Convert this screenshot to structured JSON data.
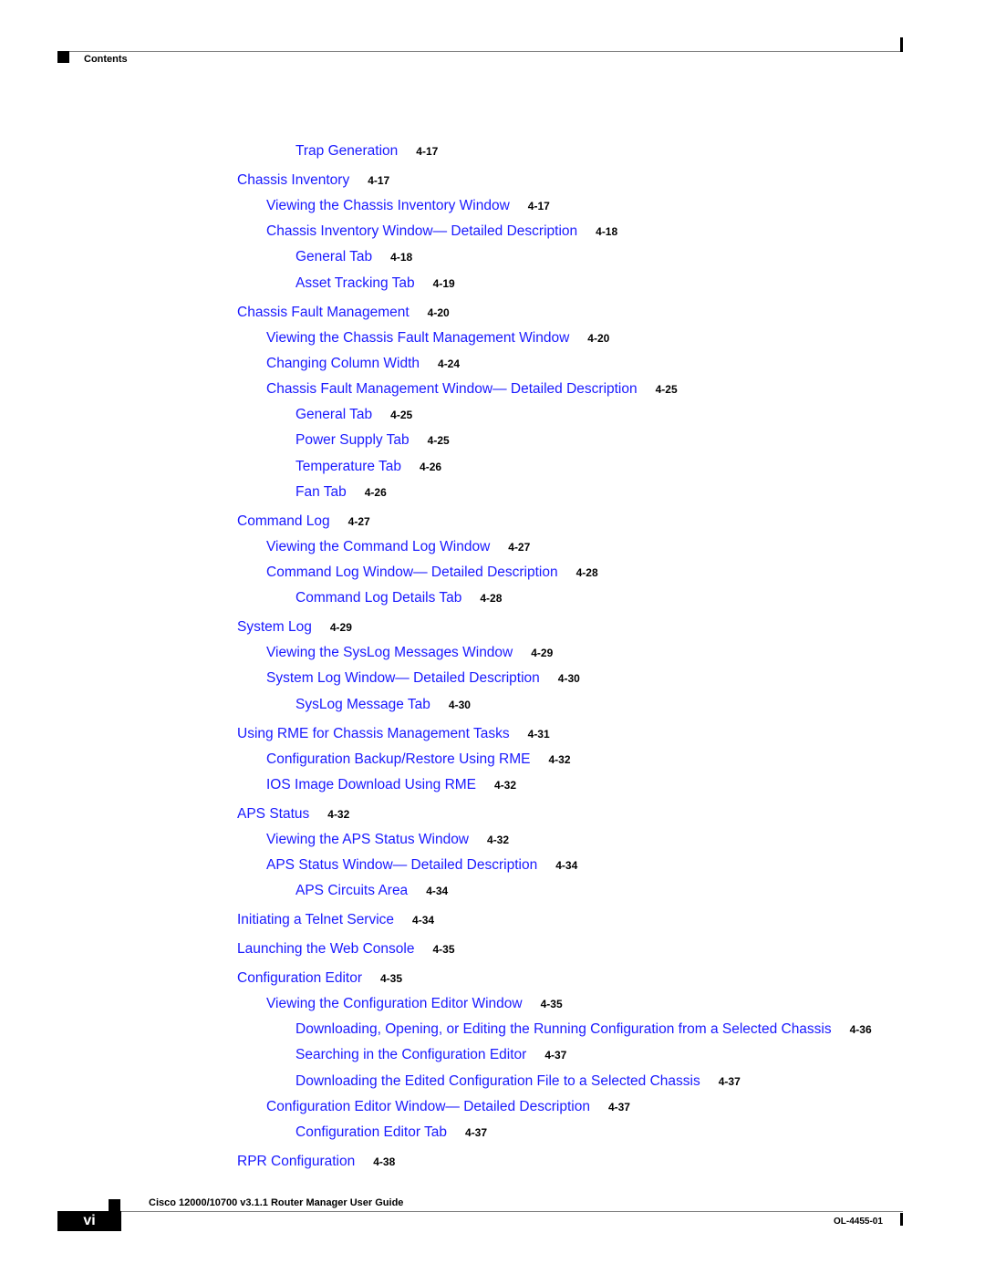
{
  "header": {
    "section_label": "Contents"
  },
  "toc": [
    {
      "level": 3,
      "title": "Trap Generation",
      "page": "4-17"
    },
    {
      "level": 1,
      "title": "Chassis Inventory",
      "page": "4-17"
    },
    {
      "level": 2,
      "title": "Viewing the Chassis Inventory Window",
      "page": "4-17"
    },
    {
      "level": 2,
      "title": "Chassis Inventory Window— Detailed Description",
      "page": "4-18"
    },
    {
      "level": 3,
      "title": "General Tab",
      "page": "4-18"
    },
    {
      "level": 3,
      "title": "Asset Tracking Tab",
      "page": "4-19"
    },
    {
      "level": 1,
      "title": "Chassis Fault Management",
      "page": "4-20"
    },
    {
      "level": 2,
      "title": "Viewing the Chassis Fault Management Window",
      "page": "4-20"
    },
    {
      "level": 2,
      "title": "Changing Column Width",
      "page": "4-24"
    },
    {
      "level": 2,
      "title": "Chassis Fault Management Window— Detailed Description",
      "page": "4-25"
    },
    {
      "level": 3,
      "title": "General Tab",
      "page": "4-25"
    },
    {
      "level": 3,
      "title": "Power Supply Tab",
      "page": "4-25"
    },
    {
      "level": 3,
      "title": "Temperature Tab",
      "page": "4-26"
    },
    {
      "level": 3,
      "title": "Fan Tab",
      "page": "4-26"
    },
    {
      "level": 1,
      "title": "Command Log",
      "page": "4-27"
    },
    {
      "level": 2,
      "title": "Viewing the Command Log Window",
      "page": "4-27"
    },
    {
      "level": 2,
      "title": "Command Log Window— Detailed Description",
      "page": "4-28"
    },
    {
      "level": 3,
      "title": "Command Log Details Tab",
      "page": "4-28"
    },
    {
      "level": 1,
      "title": "System Log",
      "page": "4-29"
    },
    {
      "level": 2,
      "title": "Viewing the SysLog Messages Window",
      "page": "4-29"
    },
    {
      "level": 2,
      "title": "System Log Window— Detailed Description",
      "page": "4-30"
    },
    {
      "level": 3,
      "title": "SysLog Message Tab",
      "page": "4-30"
    },
    {
      "level": 1,
      "title": "Using RME for Chassis Management Tasks",
      "page": "4-31"
    },
    {
      "level": 2,
      "title": "Configuration Backup/Restore Using RME",
      "page": "4-32"
    },
    {
      "level": 2,
      "title": "IOS Image Download Using RME",
      "page": "4-32"
    },
    {
      "level": 1,
      "title": "APS Status",
      "page": "4-32"
    },
    {
      "level": 2,
      "title": "Viewing the APS Status Window",
      "page": "4-32"
    },
    {
      "level": 2,
      "title": "APS Status Window— Detailed Description",
      "page": "4-34"
    },
    {
      "level": 3,
      "title": "APS Circuits Area",
      "page": "4-34"
    },
    {
      "level": 1,
      "title": "Initiating a Telnet Service",
      "page": "4-34"
    },
    {
      "level": 1,
      "title": "Launching the Web Console",
      "page": "4-35"
    },
    {
      "level": 1,
      "title": "Configuration Editor",
      "page": "4-35"
    },
    {
      "level": 2,
      "title": "Viewing the Configuration Editor Window",
      "page": "4-35"
    },
    {
      "level": 3,
      "title": "Downloading, Opening, or Editing the Running Configuration from a Selected Chassis",
      "page": "4-36"
    },
    {
      "level": 3,
      "title": "Searching in the Configuration Editor",
      "page": "4-37"
    },
    {
      "level": 3,
      "title": "Downloading the Edited Configuration File to a Selected Chassis",
      "page": "4-37"
    },
    {
      "level": 2,
      "title": "Configuration Editor Window— Detailed Description",
      "page": "4-37"
    },
    {
      "level": 3,
      "title": "Configuration Editor Tab",
      "page": "4-37"
    },
    {
      "level": 1,
      "title": "RPR Configuration",
      "page": "4-38"
    }
  ],
  "footer": {
    "book_title": "Cisco 12000/10700 v3.1.1 Router Manager User Guide",
    "page_number": "vi",
    "doc_number": "OL-4455-01"
  }
}
